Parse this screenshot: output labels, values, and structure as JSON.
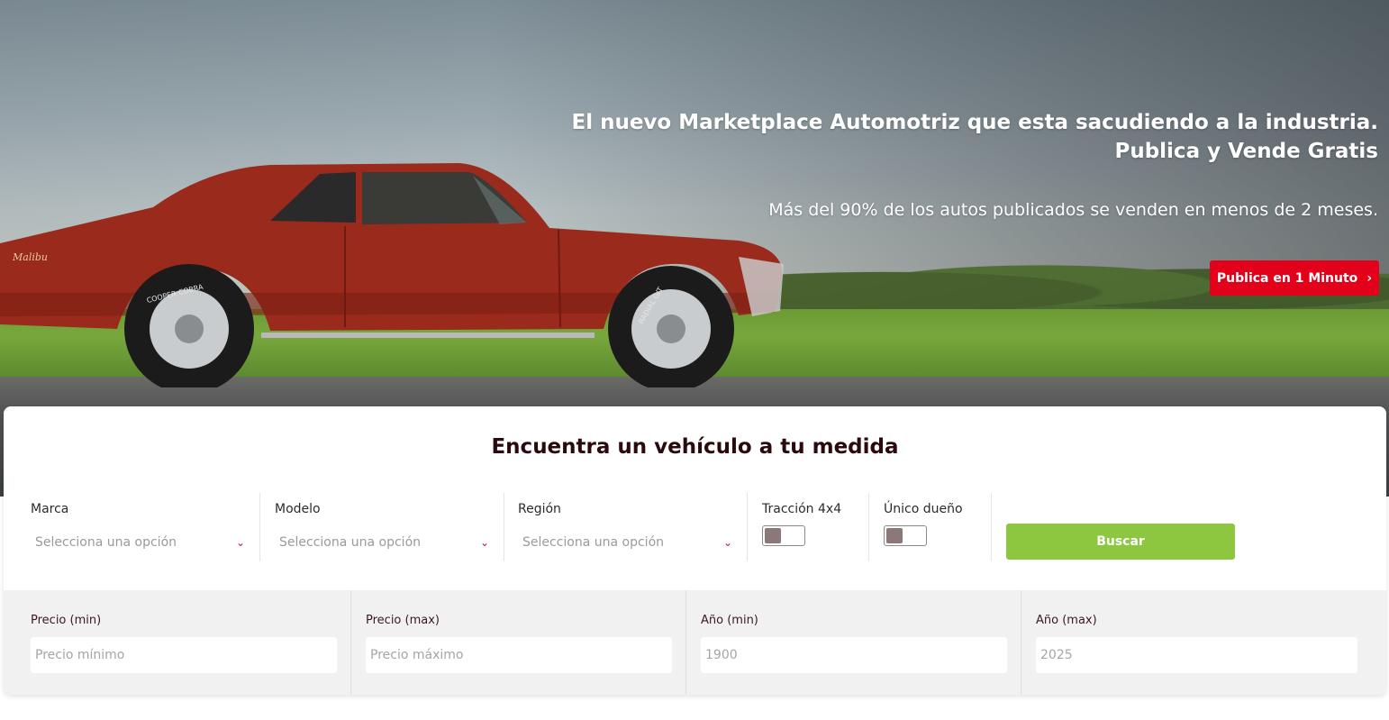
{
  "hero": {
    "title_line1": "El nuevo Marketplace Automotriz que esta sacudiendo a la industria.",
    "title_line2": "Publica y Vende Gratis",
    "subtitle": "Más del 90% de los autos publicados se venden en menos de 2 meses.",
    "publish_button": "Publica en 1 Minuto",
    "publish_chevron": "›",
    "car_badge": "Malibu",
    "tire_brand": "COOPER COBRA",
    "tire_model": "RADIAL G/T"
  },
  "search": {
    "title": "Encuentra un vehículo a tu medida",
    "marca": {
      "label": "Marca",
      "placeholder": "Selecciona una opción"
    },
    "modelo": {
      "label": "Modelo",
      "placeholder": "Selecciona una opción"
    },
    "region": {
      "label": "Región",
      "placeholder": "Selecciona una opción"
    },
    "traccion": {
      "label": "Tracción 4x4"
    },
    "unico": {
      "label": "Único dueño"
    },
    "search_button": "Buscar",
    "chevron": "⌄",
    "precio_min": {
      "label": "Precio (min)",
      "placeholder": "Precio mínimo"
    },
    "precio_max": {
      "label": "Precio (max)",
      "placeholder": "Precio máximo"
    },
    "anio_min": {
      "label": "Año (min)",
      "placeholder": "1900"
    },
    "anio_max": {
      "label": "Año (max)",
      "placeholder": "2025"
    }
  },
  "colors": {
    "brand_red": "#e3001b",
    "search_green": "#8dc63f",
    "title_dark": "#2b0a0f"
  }
}
